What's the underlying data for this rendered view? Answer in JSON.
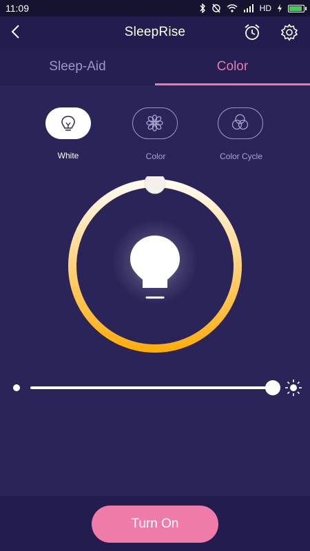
{
  "status": {
    "time": "11:09",
    "network_label": "HD"
  },
  "appbar": {
    "title": "SleepRise",
    "back_icon": "chevron-left-icon",
    "alarm_icon": "alarm-clock-icon",
    "settings_icon": "gear-icon"
  },
  "tabs": [
    {
      "label": "Sleep-Aid",
      "active": false
    },
    {
      "label": "Color",
      "active": true
    }
  ],
  "modes": [
    {
      "label": "White",
      "icon": "lightbulb-icon",
      "selected": true
    },
    {
      "label": "Color",
      "icon": "flower-icon",
      "selected": false
    },
    {
      "label": "Color Cycle",
      "icon": "overlapping-circles-icon",
      "selected": false
    }
  ],
  "color_temperature": {
    "gradient_start": "#fffaf0",
    "gradient_end": "#ffae0e",
    "knob_position": "top"
  },
  "brightness": {
    "level": 1.0,
    "min_icon": "dot-icon",
    "max_icon": "sun-icon"
  },
  "actions": {
    "turn_on_label": "Turn On"
  },
  "colors": {
    "background": "#2a2459",
    "accent": "#ef7ba9",
    "tab_active": "#e77ab0"
  }
}
